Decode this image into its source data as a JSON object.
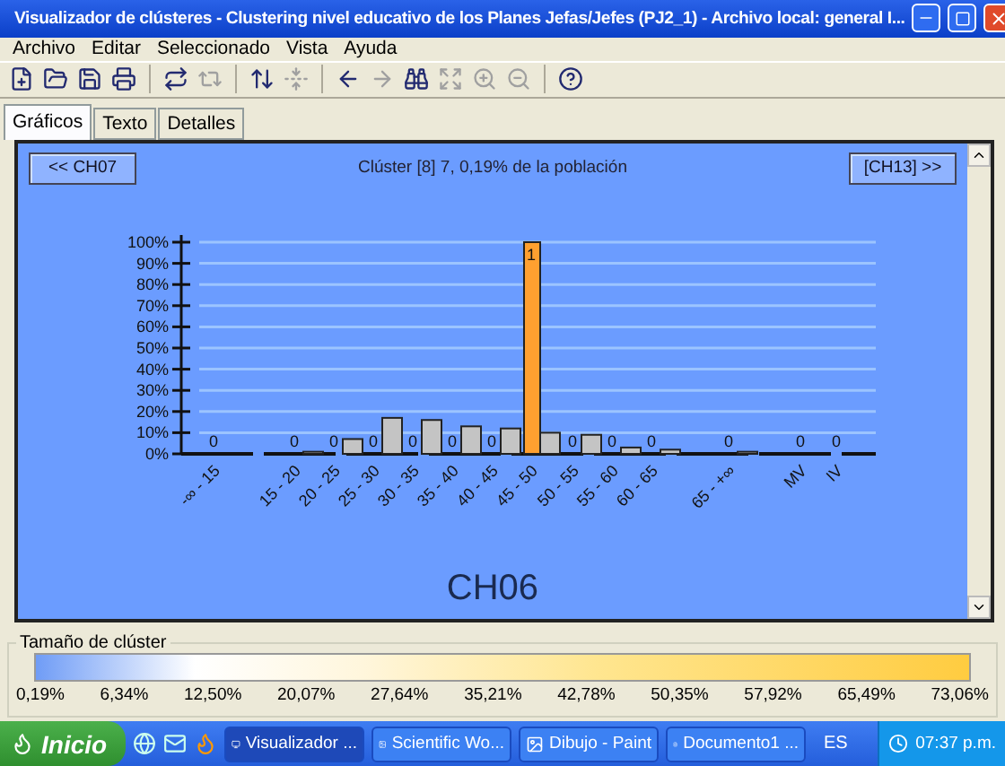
{
  "window": {
    "title": "Visualizador de clústeres - Clustering nivel educativo de los Planes Jefas/Jefes (PJ2_1) - Archivo local: general I..."
  },
  "menu": [
    {
      "label": "Archivo"
    },
    {
      "label": "Editar"
    },
    {
      "label": "Seleccionado"
    },
    {
      "label": "Vista"
    },
    {
      "label": "Ayuda"
    }
  ],
  "toolbar": [
    {
      "kind": "new",
      "disabled": false
    },
    {
      "kind": "open",
      "disabled": false
    },
    {
      "kind": "save",
      "disabled": false
    },
    {
      "kind": "print",
      "disabled": false
    },
    {
      "kind": "sep"
    },
    {
      "kind": "swap",
      "disabled": false
    },
    {
      "kind": "swapback",
      "disabled": true
    },
    {
      "kind": "sep"
    },
    {
      "kind": "sort",
      "disabled": false
    },
    {
      "kind": "fit",
      "disabled": true
    },
    {
      "kind": "sep"
    },
    {
      "kind": "back",
      "disabled": false
    },
    {
      "kind": "forward",
      "disabled": true
    },
    {
      "kind": "find",
      "disabled": false
    },
    {
      "kind": "expand",
      "disabled": true
    },
    {
      "kind": "zoomin",
      "disabled": true
    },
    {
      "kind": "zoomout",
      "disabled": true
    },
    {
      "kind": "sep"
    },
    {
      "kind": "help",
      "disabled": false
    }
  ],
  "tabs": [
    {
      "label": "Gráficos",
      "selected": true
    },
    {
      "label": "Texto",
      "selected": false
    },
    {
      "label": "Detalles",
      "selected": false
    }
  ],
  "chart_panel": {
    "prev_button": "<< CH07",
    "next_button": "[CH13] >>",
    "caption": "Clúster [8] 7, 0,19% de la población",
    "cluster_label": "CH06",
    "chart_data": {
      "type": "bar",
      "categories": [
        "-∞ - 15",
        "15 - 20",
        "20 - 25",
        "25 - 30",
        "30 - 35",
        "35 - 40",
        "40 - 45",
        "45 - 50",
        "50 - 55",
        "55 - 60",
        "60 - 65",
        "65 - +∞",
        "MV",
        "IV"
      ],
      "series": [
        {
          "color": "#ffa030",
          "values": [
            0,
            0,
            0,
            0,
            0,
            0,
            0,
            100,
            0,
            0,
            0,
            0,
            0,
            0
          ]
        },
        {
          "color": "#c4c4c4",
          "values": [
            0,
            1,
            7,
            17,
            16,
            13,
            12,
            10,
            9,
            3,
            2,
            1,
            0,
            0
          ]
        }
      ],
      "grid": true,
      "ylim": [
        0,
        100
      ],
      "yticks": [
        {
          "value": 0,
          "label": "0%"
        },
        {
          "value": 10,
          "label": "10%"
        },
        {
          "value": 20,
          "label": "20%"
        },
        {
          "value": 30,
          "label": "30%"
        },
        {
          "value": 40,
          "label": "40%"
        },
        {
          "value": 50,
          "label": "50%"
        },
        {
          "value": 60,
          "label": "60%"
        },
        {
          "value": 70,
          "label": "70%"
        },
        {
          "value": 80,
          "label": "80%"
        },
        {
          "value": 90,
          "label": "90%"
        },
        {
          "value": 100,
          "label": "100%"
        }
      ],
      "value_labels": [
        "0",
        "0",
        "0",
        "0",
        "0",
        "0",
        "0",
        "1",
        "0",
        "0",
        "0",
        "0",
        "0",
        "0"
      ]
    }
  },
  "legend": {
    "title": "Tamaño de clúster",
    "ticks": [
      "0,19%",
      "6,34%",
      "12,50%",
      "20,07%",
      "27,64%",
      "35,21%",
      "42,78%",
      "50,35%",
      "57,92%",
      "65,49%",
      "73,06%"
    ]
  },
  "taskbar": {
    "start": "Inicio",
    "tasks": [
      {
        "label": "Visualizador ...",
        "selected": true
      },
      {
        "label": "Scientific Wo...",
        "selected": false
      },
      {
        "label": "Dibujo - Paint",
        "selected": false
      },
      {
        "label": "Documento1 ...",
        "selected": false
      }
    ],
    "language": "ES",
    "clock": "07:37 p.m."
  }
}
